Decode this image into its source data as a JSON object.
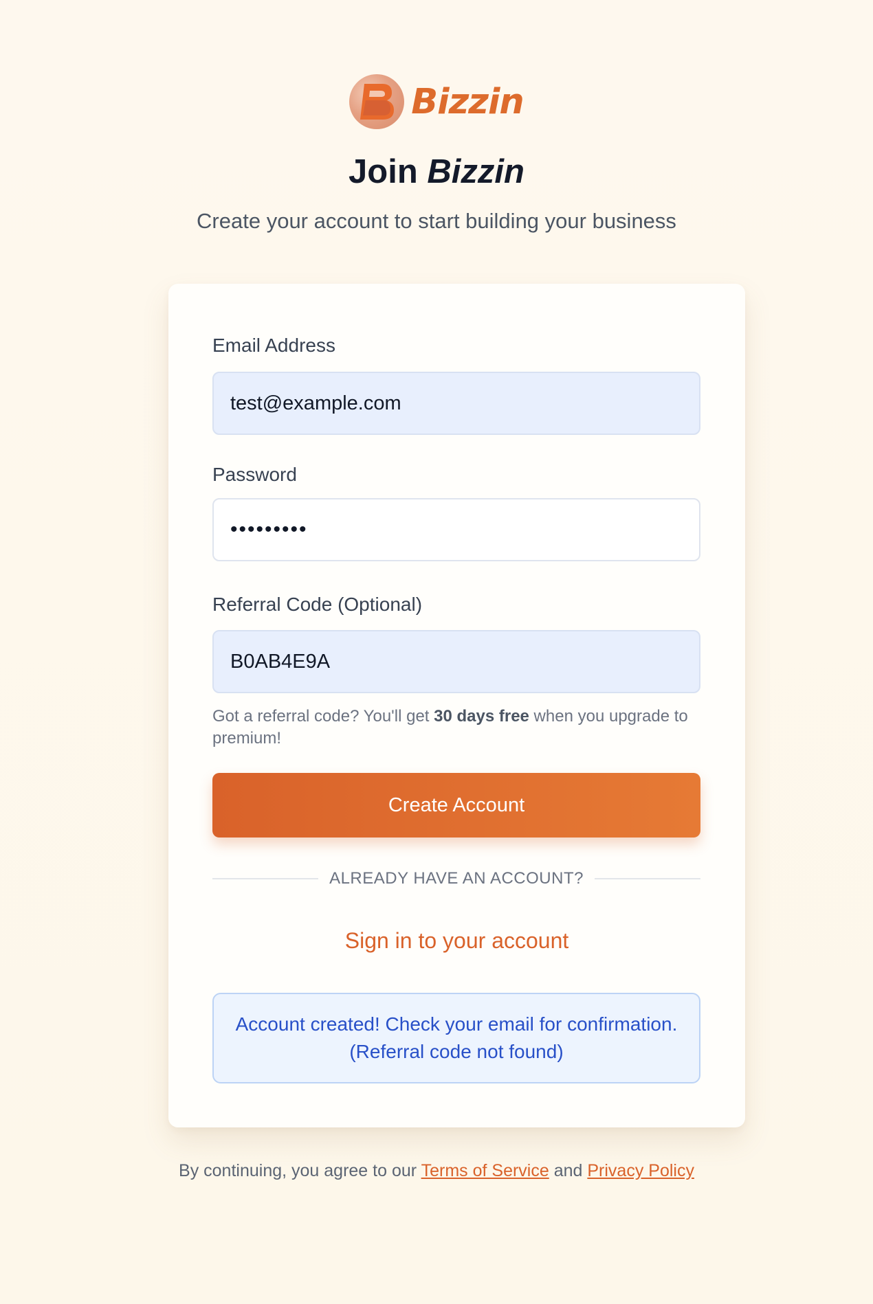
{
  "brand": {
    "name": "Bizzin",
    "logo_icon": "bizzin-b-logo",
    "accent_color": "#dd6b2c"
  },
  "header": {
    "title_prefix": "Join",
    "title_brand": "Bizzin",
    "subtitle": "Create your account to start building your business"
  },
  "form": {
    "email": {
      "label": "Email Address",
      "value": "test@example.com"
    },
    "password": {
      "label": "Password",
      "value": "•••••••••"
    },
    "referral": {
      "label": "Referral Code (Optional)",
      "value": "B0AB4E9A"
    },
    "hint": {
      "prefix": "Got a referral code? You'll get ",
      "bold": "30 days free",
      "suffix": " when you upgrade to premium!"
    },
    "submit_label": "Create Account"
  },
  "divider_text": "ALREADY HAVE AN ACCOUNT?",
  "signin_link": "Sign in to your account",
  "notice": {
    "message": "Account created! Check your email for confirmation. (Referral code not found)"
  },
  "footer": {
    "prefix": "By continuing, you agree to our ",
    "terms": "Terms of Service",
    "middle": " and ",
    "privacy": "Privacy Policy"
  }
}
